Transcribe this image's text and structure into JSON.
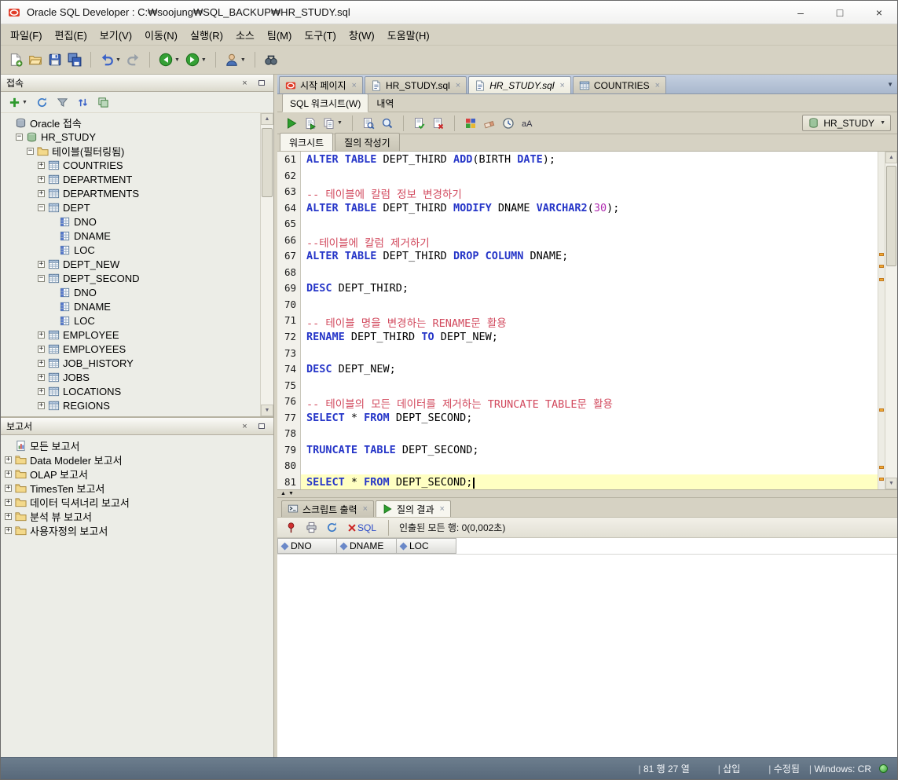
{
  "window": {
    "title": "Oracle SQL Developer : C:₩soojung₩SQL_BACKUP₩HR_STUDY.sql"
  },
  "menubar": {
    "items": [
      "파일(F)",
      "편집(E)",
      "보기(V)",
      "이동(N)",
      "실행(R)",
      "소스",
      "팀(M)",
      "도구(T)",
      "창(W)",
      "도움말(H)"
    ]
  },
  "main_toolbar": {
    "groups": [
      [
        {
          "icon": "new-file"
        },
        {
          "icon": "open-folder"
        },
        {
          "icon": "save"
        },
        {
          "icon": "save-all"
        }
      ],
      [
        {
          "icon": "undo",
          "dd": true
        },
        {
          "icon": "redo"
        }
      ],
      [
        {
          "icon": "back-nav",
          "dd": true
        },
        {
          "icon": "forward-nav",
          "dd": true
        }
      ],
      [
        {
          "icon": "connections-user",
          "dd": true
        }
      ],
      [
        {
          "icon": "search-binoculars"
        }
      ]
    ]
  },
  "connections": {
    "title": "접속",
    "toolbar": [
      {
        "icon": "add-connection",
        "dd": true
      },
      {
        "icon": "refresh"
      },
      {
        "icon": "filter"
      },
      {
        "icon": "sort-connections"
      },
      {
        "icon": "clone-connection"
      }
    ],
    "tree": [
      {
        "label": "Oracle 접속",
        "level": 0,
        "exp": "none",
        "icon": "db-root"
      },
      {
        "label": "HR_STUDY",
        "level": 1,
        "exp": "minus",
        "icon": "connection"
      },
      {
        "label": "테이블(필터링됨)",
        "level": 2,
        "exp": "minus",
        "icon": "tables-folder"
      },
      {
        "label": "COUNTRIES",
        "level": 3,
        "exp": "plus",
        "icon": "table"
      },
      {
        "label": "DEPARTMENT",
        "level": 3,
        "exp": "plus",
        "icon": "table"
      },
      {
        "label": "DEPARTMENTS",
        "level": 3,
        "exp": "plus",
        "icon": "table"
      },
      {
        "label": "DEPT",
        "level": 3,
        "exp": "minus",
        "icon": "table"
      },
      {
        "label": "DNO",
        "level": 4,
        "exp": "none",
        "icon": "column"
      },
      {
        "label": "DNAME",
        "level": 4,
        "exp": "none",
        "icon": "column"
      },
      {
        "label": "LOC",
        "level": 4,
        "exp": "none",
        "icon": "column"
      },
      {
        "label": "DEPT_NEW",
        "level": 3,
        "exp": "plus",
        "icon": "table"
      },
      {
        "label": "DEPT_SECOND",
        "level": 3,
        "exp": "minus",
        "icon": "table"
      },
      {
        "label": "DNO",
        "level": 4,
        "exp": "none",
        "icon": "column"
      },
      {
        "label": "DNAME",
        "level": 4,
        "exp": "none",
        "icon": "column"
      },
      {
        "label": "LOC",
        "level": 4,
        "exp": "none",
        "icon": "column"
      },
      {
        "label": "EMPLOYEE",
        "level": 3,
        "exp": "plus",
        "icon": "table"
      },
      {
        "label": "EMPLOYEES",
        "level": 3,
        "exp": "plus",
        "icon": "table"
      },
      {
        "label": "JOB_HISTORY",
        "level": 3,
        "exp": "plus",
        "icon": "table"
      },
      {
        "label": "JOBS",
        "level": 3,
        "exp": "plus",
        "icon": "table"
      },
      {
        "label": "LOCATIONS",
        "level": 3,
        "exp": "plus",
        "icon": "table"
      },
      {
        "label": "REGIONS",
        "level": 3,
        "exp": "plus",
        "icon": "table"
      }
    ]
  },
  "reports": {
    "title": "보고서",
    "tree": [
      {
        "label": "모든 보고서",
        "level": 0,
        "exp": "none",
        "icon": "report"
      },
      {
        "label": "Data Modeler 보고서",
        "level": 0,
        "exp": "plus",
        "icon": "folder"
      },
      {
        "label": "OLAP 보고서",
        "level": 0,
        "exp": "plus",
        "icon": "folder"
      },
      {
        "label": "TimesTen 보고서",
        "level": 0,
        "exp": "plus",
        "icon": "folder"
      },
      {
        "label": "데이터 딕셔너리 보고서",
        "level": 0,
        "exp": "plus",
        "icon": "folder"
      },
      {
        "label": "분석 뷰 보고서",
        "level": 0,
        "exp": "plus",
        "icon": "folder"
      },
      {
        "label": "사용자정의 보고서",
        "level": 0,
        "exp": "plus",
        "icon": "folder"
      }
    ]
  },
  "doc_tabs": [
    {
      "label": "시작 페이지",
      "icon": "oracle-home",
      "active": false
    },
    {
      "label": "HR_STUDY.sql",
      "icon": "sql-file",
      "active": false
    },
    {
      "label": "HR_STUDY.sql",
      "icon": "sql-file",
      "active": true
    },
    {
      "label": "COUNTRIES",
      "icon": "table",
      "active": false
    }
  ],
  "worksheet": {
    "tabs": [
      {
        "label": "SQL 워크시트(W)",
        "active": true
      },
      {
        "label": "내역",
        "active": false
      }
    ],
    "toolbar_groups": [
      [
        {
          "icon": "run-statement"
        },
        {
          "icon": "run-script"
        },
        {
          "icon": "worksheet-pages",
          "dd": true
        }
      ],
      [
        {
          "icon": "explain-plan"
        },
        {
          "icon": "autotrace"
        }
      ],
      [
        {
          "icon": "commit"
        },
        {
          "icon": "rollback"
        }
      ],
      [
        {
          "icon": "query-builder"
        },
        {
          "icon": "clear"
        },
        {
          "icon": "history"
        },
        {
          "icon": "case-toggle"
        }
      ]
    ],
    "connection": "HR_STUDY",
    "subtabs": [
      {
        "label": "워크시트",
        "active": true
      },
      {
        "label": "질의 작성기",
        "active": false
      }
    ]
  },
  "editor": {
    "current_line": 81,
    "change_markers": [
      0.3,
      0.335,
      0.375,
      0.76,
      0.93,
      0.965
    ],
    "lines": [
      {
        "n": 61,
        "t": [
          [
            "k",
            "ALTER TABLE"
          ],
          [
            "p",
            " DEPT_THIRD "
          ],
          [
            "k",
            "ADD"
          ],
          [
            "p",
            "(BIRTH "
          ],
          [
            "k",
            "DATE"
          ],
          [
            "p",
            ");"
          ]
        ]
      },
      {
        "n": 62,
        "t": []
      },
      {
        "n": 63,
        "t": [
          [
            "c",
            "-- 테이블에 칼럼 정보 변경하기"
          ]
        ]
      },
      {
        "n": 64,
        "t": [
          [
            "k",
            "ALTER TABLE"
          ],
          [
            "p",
            " DEPT_THIRD "
          ],
          [
            "k",
            "MODIFY"
          ],
          [
            "p",
            " DNAME "
          ],
          [
            "k",
            "VARCHAR2"
          ],
          [
            "p",
            "("
          ],
          [
            "n",
            "30"
          ],
          [
            "p",
            ");"
          ]
        ]
      },
      {
        "n": 65,
        "t": []
      },
      {
        "n": 66,
        "t": [
          [
            "c",
            "--테이블에 칼럼 제거하기"
          ]
        ]
      },
      {
        "n": 67,
        "t": [
          [
            "k",
            "ALTER TABLE"
          ],
          [
            "p",
            " DEPT_THIRD "
          ],
          [
            "k",
            "DROP COLUMN"
          ],
          [
            "p",
            " DNAME;"
          ]
        ]
      },
      {
        "n": 68,
        "t": []
      },
      {
        "n": 69,
        "t": [
          [
            "k",
            "DESC"
          ],
          [
            "p",
            " DEPT_THIRD;"
          ]
        ]
      },
      {
        "n": 70,
        "t": []
      },
      {
        "n": 71,
        "t": [
          [
            "c",
            "-- 테이블 명을 변경하는 RENAME문 활용"
          ]
        ]
      },
      {
        "n": 72,
        "t": [
          [
            "k",
            "RENAME"
          ],
          [
            "p",
            " DEPT_THIRD "
          ],
          [
            "k",
            "TO"
          ],
          [
            "p",
            " DEPT_NEW;"
          ]
        ]
      },
      {
        "n": 73,
        "t": []
      },
      {
        "n": 74,
        "t": [
          [
            "k",
            "DESC"
          ],
          [
            "p",
            " DEPT_NEW;"
          ]
        ]
      },
      {
        "n": 75,
        "t": []
      },
      {
        "n": 76,
        "t": [
          [
            "c",
            "-- 테이블의 모든 데이터를 제거하는 TRUNCATE TABLE문 활용"
          ]
        ]
      },
      {
        "n": 77,
        "t": [
          [
            "k",
            "SELECT"
          ],
          [
            "p",
            " * "
          ],
          [
            "k",
            "FROM"
          ],
          [
            "p",
            " DEPT_SECOND;"
          ]
        ]
      },
      {
        "n": 78,
        "t": []
      },
      {
        "n": 79,
        "t": [
          [
            "k",
            "TRUNCATE TABLE"
          ],
          [
            "p",
            " DEPT_SECOND;"
          ]
        ]
      },
      {
        "n": 80,
        "t": []
      },
      {
        "n": 81,
        "t": [
          [
            "k",
            "SELECT"
          ],
          [
            "p",
            " * "
          ],
          [
            "k",
            "FROM"
          ],
          [
            "p",
            " DEPT_SECOND;"
          ]
        ]
      }
    ]
  },
  "output": {
    "tabs": [
      {
        "label": "스크립트 출력",
        "icon": "script-output",
        "active": false
      },
      {
        "label": "질의 결과",
        "icon": "query-result",
        "active": true
      }
    ],
    "toolbar": {
      "sql_label": "SQL",
      "fetch_status": "인출된 모든 행: 0(0,002초)"
    },
    "grid_columns": [
      "DNO",
      "DNAME",
      "LOC"
    ]
  },
  "statusbar": {
    "position": "81 행 27 열",
    "mode": "삽입",
    "modified": "수정됨",
    "encoding": "Windows: CR"
  }
}
